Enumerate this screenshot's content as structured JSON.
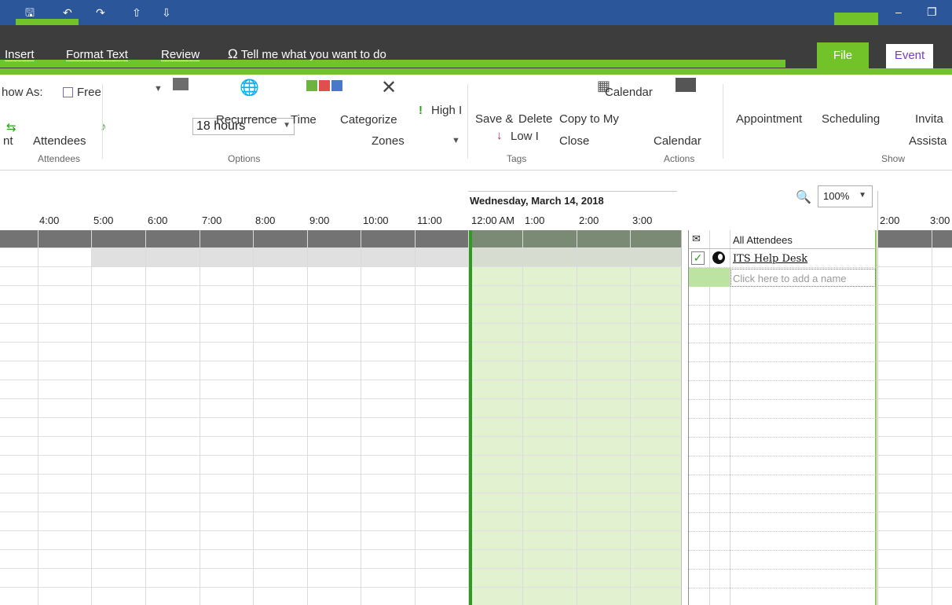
{
  "colors": {
    "title_blue": "#2b579a",
    "accent_lime": "#72c22a",
    "dark_band": "#3d3d3d",
    "busy_band": "#737373",
    "selection_green": "#e2f1d0",
    "now_line": "#2f9b1e",
    "event_tab_text": "#7a3cb8"
  },
  "tabs": {
    "insert": "Insert",
    "format_text": "Format Text",
    "review": "Review",
    "tell_me": "Tell me what you want to do",
    "file": "File",
    "event": "Event"
  },
  "ribbon": {
    "show_as_label": "how As:",
    "show_as_value": "Free",
    "reminder_value": "18 hours",
    "recurrence": "Recurrence",
    "time": "Time",
    "zones": "Zones",
    "categorize": "Categorize",
    "high": "High I",
    "low": "Low I",
    "save_close_top": "Save &",
    "save_close_bottom": "Close",
    "delete": "Delete",
    "copy_to_my_top": "Copy to My",
    "copy_to_my_bottom": "Calendar",
    "calendar": "Calendar",
    "appointment": "Appointment",
    "scheduling": "Scheduling",
    "invite_top": "Invita",
    "invite_bottom": "Assista",
    "attendees_left": "nt",
    "attendees_btn": "Attendees",
    "group_attendees": "Attendees",
    "group_options": "Options",
    "group_tags": "Tags",
    "group_actions": "Actions",
    "group_show": "Show"
  },
  "scheduler": {
    "date": "Wednesday, March 14, 2018",
    "hours": [
      "4:00",
      "5:00",
      "6:00",
      "7:00",
      "8:00",
      "9:00",
      "10:00",
      "11:00",
      "12:00 AM",
      "1:00",
      "2:00",
      "3:00"
    ],
    "right_hours": [
      "2:00",
      "3:00"
    ],
    "zoom": "100%",
    "all_attendees": "All Attendees",
    "attendee_name": "ITS Help Desk",
    "add_name_placeholder": "Click here to add a name"
  }
}
